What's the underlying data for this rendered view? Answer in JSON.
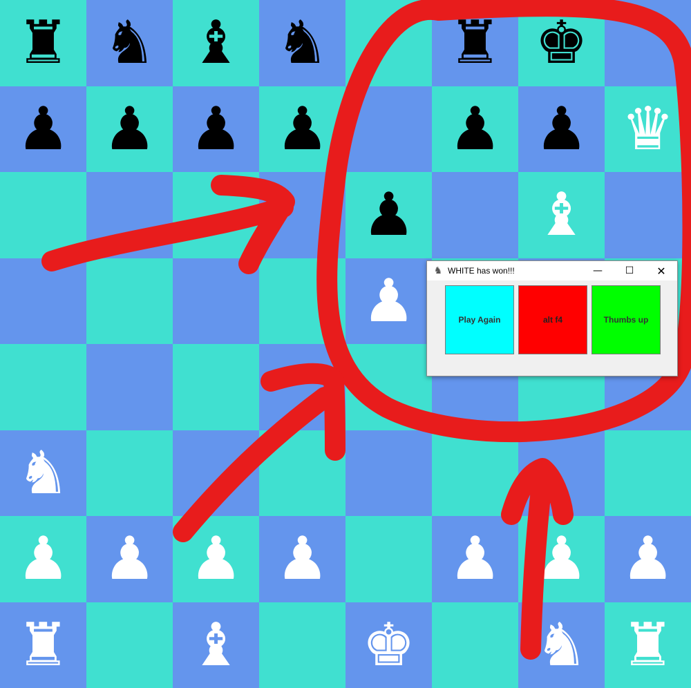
{
  "colors": {
    "light_square": "#40E0D0",
    "dark_square": "#6495ED",
    "annotation": "#E81C1C"
  },
  "board": {
    "rows": [
      [
        {
          "piece": "rook",
          "color": "black",
          "glyph": "♜"
        },
        {
          "piece": "knight",
          "color": "black",
          "glyph": "♞"
        },
        {
          "piece": "bishop",
          "color": "black",
          "glyph": "♝"
        },
        {
          "piece": "knight",
          "color": "black",
          "glyph": "♞"
        },
        null,
        {
          "piece": "rook",
          "color": "black",
          "glyph": "♜"
        },
        {
          "piece": "king",
          "color": "black",
          "glyph": "♚"
        },
        null
      ],
      [
        {
          "piece": "pawn",
          "color": "black",
          "glyph": "♟"
        },
        {
          "piece": "pawn",
          "color": "black",
          "glyph": "♟"
        },
        {
          "piece": "pawn",
          "color": "black",
          "glyph": "♟"
        },
        {
          "piece": "pawn",
          "color": "black",
          "glyph": "♟"
        },
        null,
        {
          "piece": "pawn",
          "color": "black",
          "glyph": "♟"
        },
        {
          "piece": "pawn",
          "color": "black",
          "glyph": "♟"
        },
        {
          "piece": "queen",
          "color": "white",
          "glyph": "♛"
        }
      ],
      [
        null,
        null,
        null,
        null,
        {
          "piece": "pawn",
          "color": "black",
          "glyph": "♟"
        },
        null,
        {
          "piece": "bishop",
          "color": "white",
          "glyph": "♝"
        },
        null
      ],
      [
        null,
        null,
        null,
        null,
        {
          "piece": "pawn",
          "color": "white",
          "glyph": "♟"
        },
        null,
        null,
        null
      ],
      [
        null,
        null,
        null,
        null,
        null,
        null,
        null,
        null
      ],
      [
        {
          "piece": "knight",
          "color": "white",
          "glyph": "♞"
        },
        null,
        null,
        null,
        null,
        null,
        null,
        null
      ],
      [
        {
          "piece": "pawn",
          "color": "white",
          "glyph": "♟"
        },
        {
          "piece": "pawn",
          "color": "white",
          "glyph": "♟"
        },
        {
          "piece": "pawn",
          "color": "white",
          "glyph": "♟"
        },
        {
          "piece": "pawn",
          "color": "white",
          "glyph": "♟"
        },
        null,
        {
          "piece": "pawn",
          "color": "white",
          "glyph": "♟"
        },
        {
          "piece": "pawn",
          "color": "white",
          "glyph": "♟"
        },
        {
          "piece": "pawn",
          "color": "white",
          "glyph": "♟"
        }
      ],
      [
        {
          "piece": "rook",
          "color": "white",
          "glyph": "♜"
        },
        null,
        {
          "piece": "bishop",
          "color": "white",
          "glyph": "♝"
        },
        null,
        {
          "piece": "king",
          "color": "white",
          "glyph": "♚"
        },
        null,
        {
          "piece": "knight",
          "color": "white",
          "glyph": "♞"
        },
        {
          "piece": "rook",
          "color": "white",
          "glyph": "♜"
        }
      ]
    ]
  },
  "dialog": {
    "title": "WHITE has won!!!",
    "app_icon": "chess-app-icon",
    "window_controls": {
      "minimize": "—",
      "maximize": "☐",
      "close": "✕"
    },
    "buttons": [
      {
        "label": "Play Again",
        "color": "#00FFFF",
        "text_color": "#333333"
      },
      {
        "label": "alt f4",
        "color": "#FF0000",
        "text_color": "#222222"
      },
      {
        "label": "Thumbs up",
        "color": "#00FF00",
        "text_color": "#333333"
      }
    ]
  }
}
